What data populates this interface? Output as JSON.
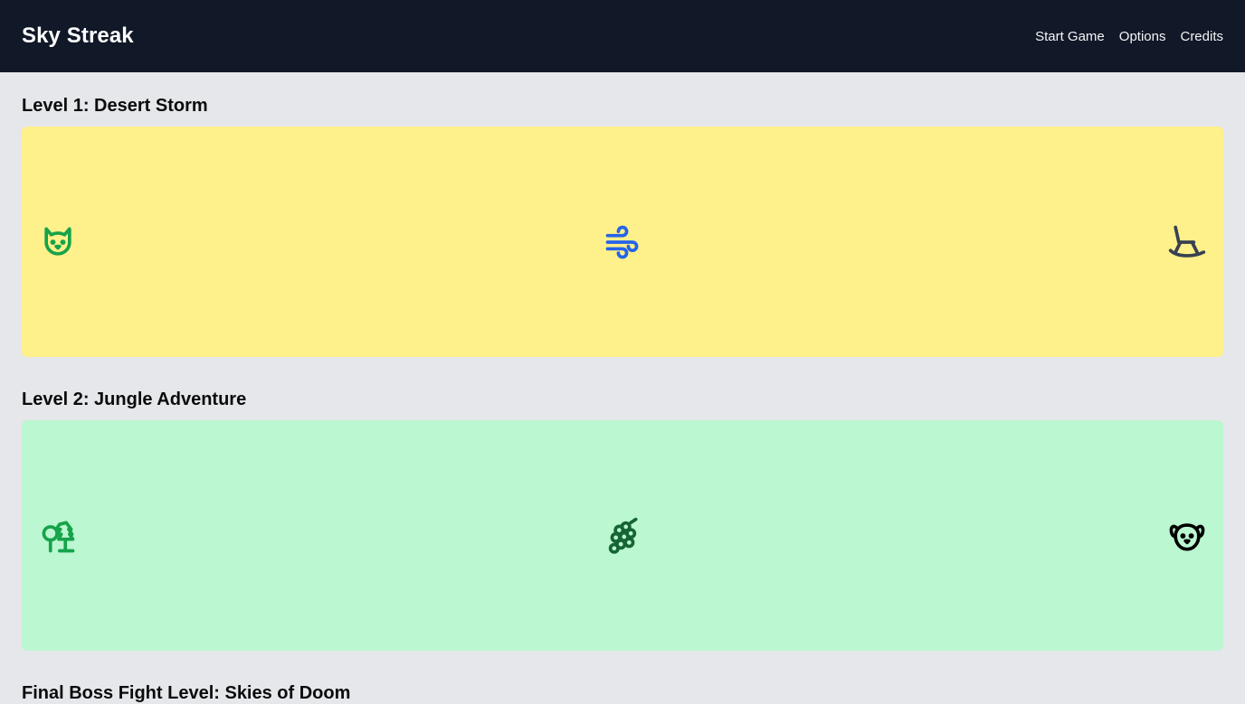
{
  "app": {
    "title": "Sky Streak"
  },
  "nav": {
    "items": [
      "Start Game",
      "Options",
      "Credits"
    ]
  },
  "levels": [
    {
      "title": "Level 1: Desert Storm",
      "bg": "#fef08a",
      "icons": [
        {
          "name": "cat-icon",
          "color": "#16a34a"
        },
        {
          "name": "wind-icon",
          "color": "#2563eb"
        },
        {
          "name": "rocking-chair-icon",
          "color": "#374151"
        }
      ]
    },
    {
      "title": "Level 2: Jungle Adventure",
      "bg": "#bbf7d0",
      "icons": [
        {
          "name": "trees-icon",
          "color": "#16a34a"
        },
        {
          "name": "grapes-icon",
          "color": "#166534"
        },
        {
          "name": "dog-icon",
          "color": "#000000"
        }
      ]
    },
    {
      "title": "Final Boss Fight Level: Skies of Doom"
    }
  ]
}
